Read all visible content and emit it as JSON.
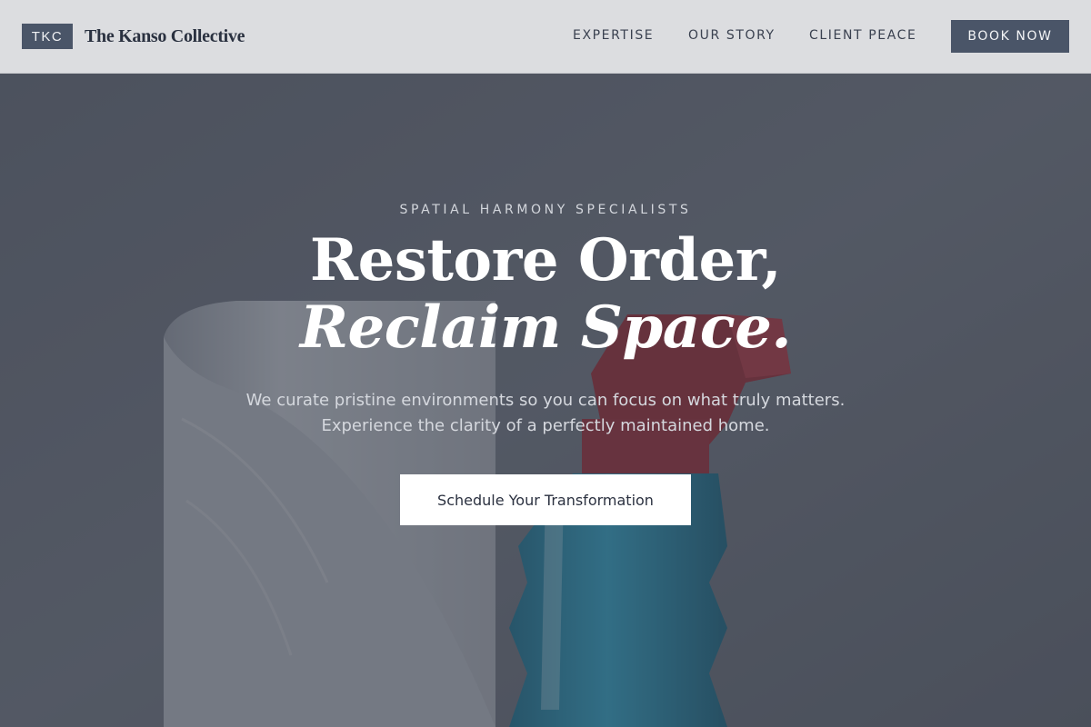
{
  "header": {
    "logo_text": "TKC",
    "brand_name": "The Kanso Collective",
    "nav": [
      {
        "label": "EXPERTISE"
      },
      {
        "label": "OUR STORY"
      },
      {
        "label": "CLIENT PEACE"
      }
    ],
    "book_label": "BOOK NOW"
  },
  "hero": {
    "eyebrow": "SPATIAL HARMONY SPECIALISTS",
    "headline_line1": "Restore Order,",
    "headline_line2": "Reclaim Space.",
    "subtext_line1": "We curate pristine environments so you can focus on what truly matters.",
    "subtext_line2": "Experience the clarity of a perfectly maintained home.",
    "cta_label": "Schedule Your Transformation",
    "background_image": "paper-towel-roll-and-spray-bottle"
  },
  "colors": {
    "header_bg": "#dcdde0",
    "accent": "#4a5568",
    "hero_overlay": "#4a4f58",
    "cta_bg": "#ffffff"
  }
}
